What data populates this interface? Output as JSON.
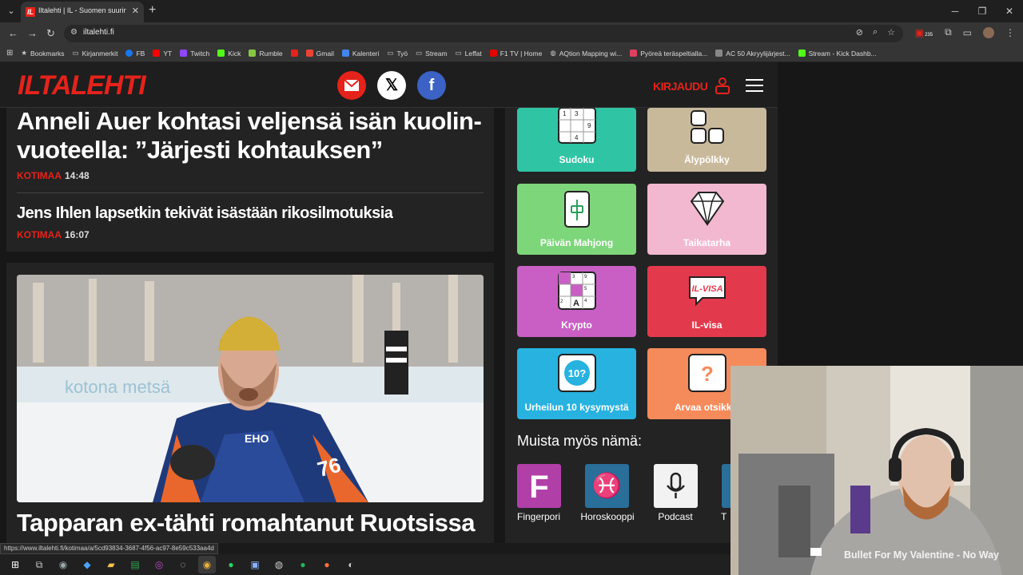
{
  "browser": {
    "tab_title": "Iltalehti | IL - Suomen suurin uu",
    "tab_favicon": "IL",
    "url": "iltalehti.fi",
    "extension_badge": "235"
  },
  "bookmarks": [
    {
      "label": "Bookmarks",
      "icon": "star-icon",
      "color": "#bbbbbb"
    },
    {
      "label": "Kirjanmerkit",
      "icon": "folder-icon",
      "color": "#bbbbbb"
    },
    {
      "label": "FB",
      "icon": "facebook-icon",
      "color": "#1877f2"
    },
    {
      "label": "YT",
      "icon": "youtube-icon",
      "color": "#ff0000"
    },
    {
      "label": "Twitch",
      "icon": "twitch-icon",
      "color": "#9146ff"
    },
    {
      "label": "Kick",
      "icon": "kick-icon",
      "color": "#53fc18"
    },
    {
      "label": "Rumble",
      "icon": "rumble-icon",
      "color": "#85c742"
    },
    {
      "label": "",
      "icon": "iltalehti-icon",
      "color": "#e5231b"
    },
    {
      "label": "Gmail",
      "icon": "gmail-icon",
      "color": "#ea4335"
    },
    {
      "label": "Kalenteri",
      "icon": "calendar-icon",
      "color": "#4285f4"
    },
    {
      "label": "Työ",
      "icon": "folder-icon",
      "color": "#bbbbbb"
    },
    {
      "label": "Stream",
      "icon": "folder-icon",
      "color": "#bbbbbb"
    },
    {
      "label": "Leffat",
      "icon": "folder-icon",
      "color": "#bbbbbb"
    },
    {
      "label": "F1 TV | Home",
      "icon": "f1-icon",
      "color": "#e10600"
    },
    {
      "label": "AQtion Mapping wi...",
      "icon": "globe-icon",
      "color": "#bbbbbb"
    },
    {
      "label": "Pyöreä teräspeltialla...",
      "icon": "bookmark-icon",
      "color": "#e04060"
    },
    {
      "label": "AC 50 Akryylijärjest...",
      "icon": "page-icon",
      "color": "#888888"
    },
    {
      "label": "Stream - Kick Dashb...",
      "icon": "kick-icon",
      "color": "#53fc18"
    }
  ],
  "site": {
    "logo": "ILTALEHTI",
    "login": "KIRJAUDU"
  },
  "articles": [
    {
      "title": "Anneli Auer kohtasi veljensä isän kuolin-vuoteella: ”Järjesti kohtauksen”",
      "category": "KOTIMAA",
      "time": "14:48"
    },
    {
      "title": "Jens Ihlen lapsetkin tekivät isästään rikosilmotuksia",
      "category": "KOTIMAA",
      "time": "16:07"
    },
    {
      "title": "Tapparan ex-tähti romahtanut Ruotsissa",
      "category": "",
      "time": ""
    }
  ],
  "photo": {
    "jersey_number": "76",
    "sponsor": "EHO"
  },
  "games": [
    {
      "label": "Sudoku",
      "color": "#2fc4a4",
      "icon": "sudoku-icon"
    },
    {
      "label": "Älypölkky",
      "color": "#c9b99b",
      "icon": "blocks-icon"
    },
    {
      "label": "Päivän Mahjong",
      "color": "#7ed67a",
      "icon": "mahjong-icon"
    },
    {
      "label": "Taikatarha",
      "color": "#f2b8cf",
      "icon": "diamond-icon"
    },
    {
      "label": "Krypto",
      "color": "#c95fc4",
      "icon": "crossword-icon"
    },
    {
      "label": "IL-visa",
      "color": "#e3394d",
      "icon": "quiz-icon"
    },
    {
      "label": "Urheilun 10 kysymystä",
      "color": "#27b2e0",
      "icon": "ten-questions-icon"
    },
    {
      "label": "Arvaa otsikk",
      "color": "#f58a5a",
      "icon": "question-icon"
    }
  ],
  "icon_text": {
    "sudoku": [
      "1",
      "3",
      "9",
      "4"
    ],
    "quiz": "IL-VISA",
    "ten": "10?",
    "question": "?",
    "crossword": [
      "3",
      "9",
      "5",
      "2",
      "A",
      "4"
    ]
  },
  "muista": {
    "heading": "Muista myös nämä:",
    "items": [
      {
        "label": "Fingerpori",
        "color": "#b03fa8",
        "glyph": "F"
      },
      {
        "label": "Horoskooppi",
        "color": "#2a6e9a",
        "glyph": "♓"
      },
      {
        "label": "Podcast",
        "color": "#f2f2f2",
        "glyph": "🎙"
      },
      {
        "label": "T",
        "color": "#2a6e9a",
        "glyph": ""
      }
    ]
  },
  "status_url": "https://www.iltalehti.fi/kotimaa/a/5cd93834-3687-4f56-ac97-8e59c533aa4d",
  "overlay": {
    "song": "Bullet For My Valentine  -  No Way"
  }
}
